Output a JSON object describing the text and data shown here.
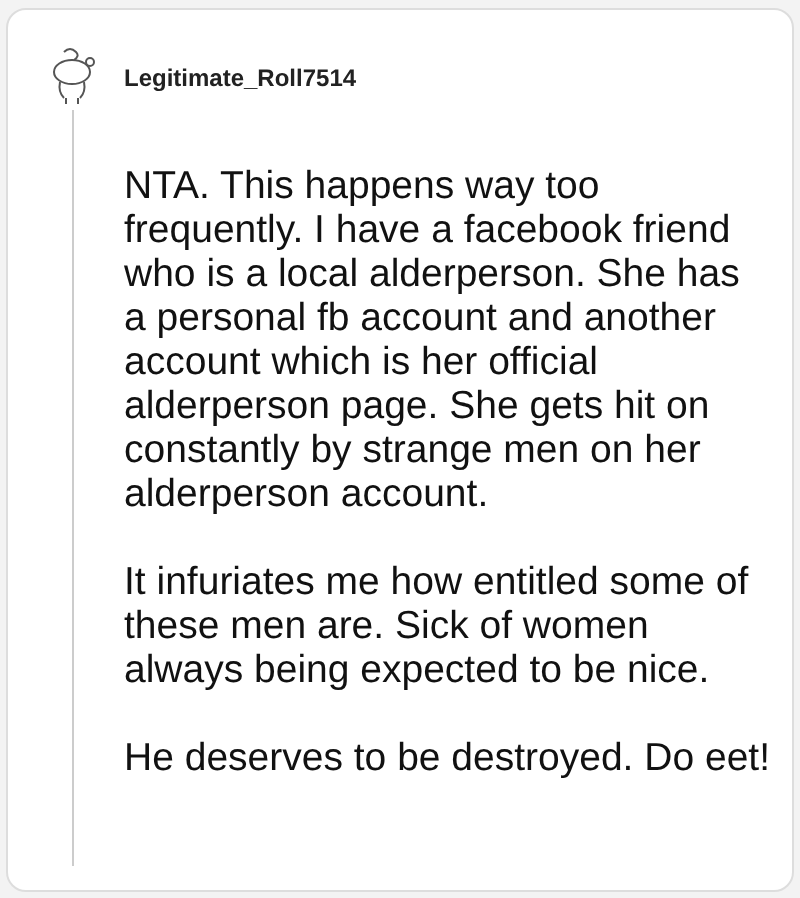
{
  "comment": {
    "author": "Legitimate_Roll7514",
    "paragraphs": [
      "NTA. This happens way too frequently. I have a facebook friend who is a local alderperson. She has a personal fb account and another account which is her official alderperson page. She gets hit on constantly by strange men on her alderperson account.",
      "It infuriates me how entitled some of these men are. Sick of women always being expected to be nice.",
      "He deserves to be destroyed. Do eet!"
    ]
  }
}
